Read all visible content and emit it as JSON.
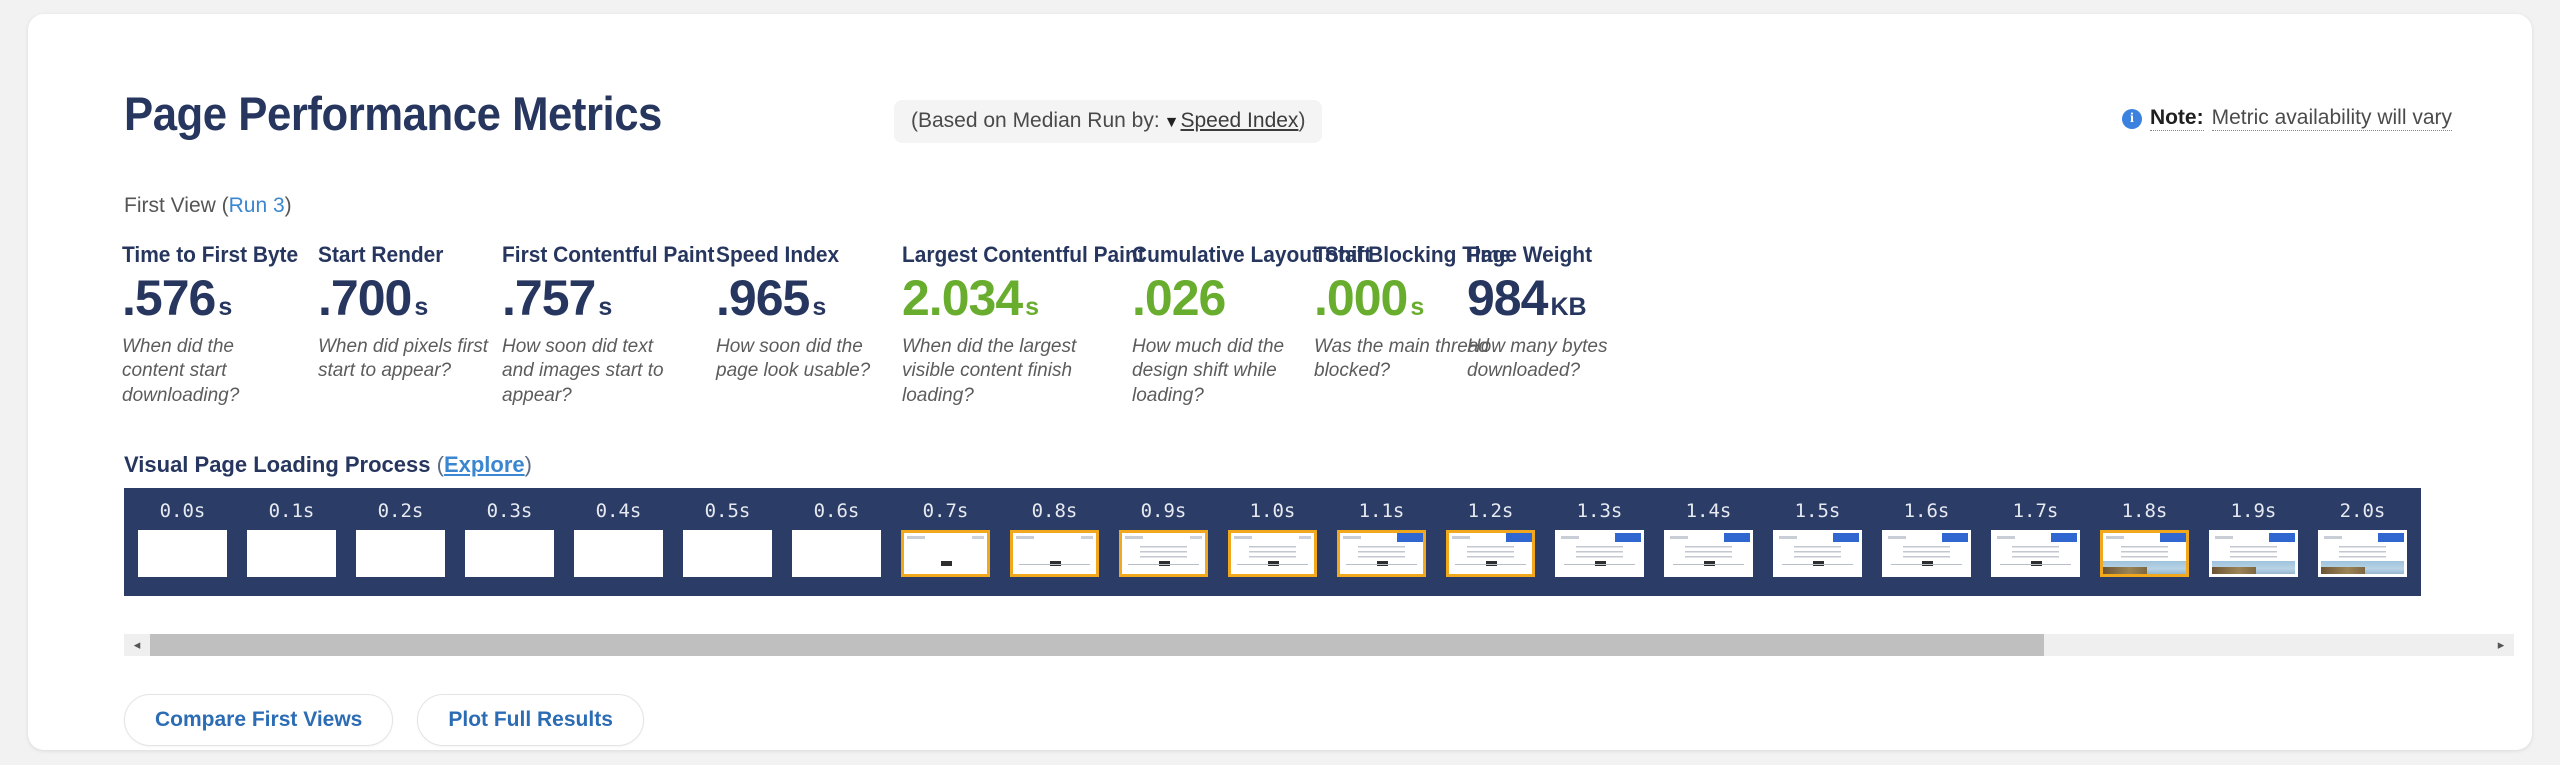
{
  "header": {
    "title": "Page Performance Metrics",
    "median_badge": {
      "prefix": "(Based on Median Run by:",
      "caret": "▼",
      "selected": "Speed Index",
      "suffix": ")"
    },
    "note": {
      "icon": "info-icon",
      "label": "Note:",
      "text": "Metric availability will vary"
    }
  },
  "run_line": {
    "prefix": "First View (",
    "link": "Run 3",
    "suffix": ")"
  },
  "metrics": [
    {
      "title": "Time to First Byte",
      "value": ".576",
      "unit": "s",
      "desc": "When did the content start downloading?",
      "color": "#27365e"
    },
    {
      "title": "Start Render",
      "value": ".700",
      "unit": "s",
      "desc": "When did pixels first start to appear?",
      "color": "#27365e"
    },
    {
      "title": "First Contentful Paint",
      "value": ".757",
      "unit": "s",
      "desc": "How soon did text and images start to appear?",
      "color": "#27365e"
    },
    {
      "title": "Speed Index",
      "value": ".965",
      "unit": "s",
      "desc": "How soon did the page look usable?",
      "color": "#27365e"
    },
    {
      "title": "Largest Contentful Paint",
      "value": "2.034",
      "unit": "s",
      "desc": "When did the largest visible content finish loading?",
      "color": "#68ad2e"
    },
    {
      "title": "Cumulative Layout Shift",
      "value": ".026",
      "unit": "",
      "desc": "How much did the design shift while loading?",
      "color": "#68ad2e"
    },
    {
      "title": "Total Blocking Time",
      "value": ".000",
      "unit": "s",
      "desc": "Was the main thread blocked?",
      "color": "#68ad2e"
    },
    {
      "title": "Page Weight",
      "value": "984",
      "unit": "KB",
      "desc": "How many bytes downloaded?",
      "color": "#27365e"
    }
  ],
  "filmstrip": {
    "heading": "Visual Page Loading Process",
    "explore_open": "(",
    "explore_link": "Explore",
    "explore_close": ")",
    "frames": [
      {
        "label": "0.0s",
        "state": "blank",
        "highlight": false
      },
      {
        "label": "0.1s",
        "state": "blank",
        "highlight": false
      },
      {
        "label": "0.2s",
        "state": "blank",
        "highlight": false
      },
      {
        "label": "0.3s",
        "state": "blank",
        "highlight": false
      },
      {
        "label": "0.4s",
        "state": "blank",
        "highlight": false
      },
      {
        "label": "0.5s",
        "state": "blank",
        "highlight": false
      },
      {
        "label": "0.6s",
        "state": "blank",
        "highlight": false
      },
      {
        "label": "0.7s",
        "state": "button",
        "highlight": true
      },
      {
        "label": "0.8s",
        "state": "button-rule",
        "highlight": true
      },
      {
        "label": "0.9s",
        "state": "text",
        "highlight": true
      },
      {
        "label": "1.0s",
        "state": "text",
        "highlight": true
      },
      {
        "label": "1.1s",
        "state": "text-blue",
        "highlight": true
      },
      {
        "label": "1.2s",
        "state": "text-blue",
        "highlight": true
      },
      {
        "label": "1.3s",
        "state": "text-blue",
        "highlight": false
      },
      {
        "label": "1.4s",
        "state": "text-blue",
        "highlight": false
      },
      {
        "label": "1.5s",
        "state": "text-blue",
        "highlight": false
      },
      {
        "label": "1.6s",
        "state": "text-blue",
        "highlight": false
      },
      {
        "label": "1.7s",
        "state": "text-blue",
        "highlight": false
      },
      {
        "label": "1.8s",
        "state": "photo",
        "highlight": true
      },
      {
        "label": "1.9s",
        "state": "photo",
        "highlight": false
      },
      {
        "label": "2.0s",
        "state": "photo",
        "highlight": false
      }
    ]
  },
  "scrollbar": {
    "left_arrow": "◂",
    "right_arrow": "▸",
    "thumb_percent": 81
  },
  "buttons": [
    {
      "label": "Compare First Views"
    },
    {
      "label": "Plot Full Results"
    }
  ],
  "colors": {
    "navy": "#27365e",
    "green": "#68ad2e",
    "link_blue": "#3a86d0",
    "highlight_orange": "#f2a81d",
    "filmstrip_bg": "#2b3c66"
  }
}
